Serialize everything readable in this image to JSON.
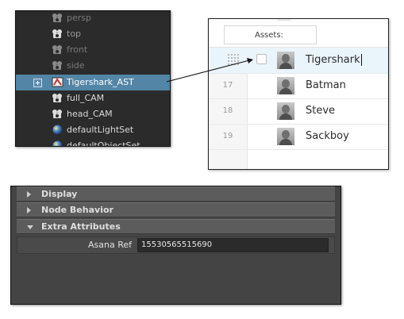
{
  "outliner": {
    "items": [
      {
        "label": "persp",
        "icon": "camera-icon",
        "state": "dim"
      },
      {
        "label": "top",
        "icon": "camera-icon",
        "state": "normal"
      },
      {
        "label": "front",
        "icon": "camera-icon",
        "state": "dim"
      },
      {
        "label": "side",
        "icon": "camera-icon",
        "state": "dim"
      },
      {
        "label": "Tigershark_AST",
        "icon": "asset-node-icon",
        "state": "selected"
      },
      {
        "label": "full_CAM",
        "icon": "camera-icon",
        "state": "normal"
      },
      {
        "label": "head_CAM",
        "icon": "camera-icon",
        "state": "normal"
      },
      {
        "label": "defaultLightSet",
        "icon": "sphere-icon",
        "state": "normal"
      },
      {
        "label": "defaultObjectSet",
        "icon": "sphere-icon",
        "state": "normal"
      }
    ]
  },
  "asana": {
    "section_header": "Assets:",
    "tasks": [
      {
        "number": "",
        "name": "Tigershark",
        "highlighted": true
      },
      {
        "number": "17",
        "name": "Batman",
        "highlighted": false
      },
      {
        "number": "18",
        "name": "Steve",
        "highlighted": false
      },
      {
        "number": "19",
        "name": "Sackboy",
        "highlighted": false
      }
    ]
  },
  "attribute_editor": {
    "sections": [
      {
        "title": "Display",
        "expanded": false
      },
      {
        "title": "Node Behavior",
        "expanded": false
      },
      {
        "title": "Extra Attributes",
        "expanded": true
      }
    ],
    "attribute": {
      "label": "Asana Ref",
      "value": "15530565515690"
    }
  },
  "colors": {
    "selection": "#5285a6",
    "outliner_bg": "#2b2b2b",
    "attr_panel_bg": "#444444",
    "asana_highlight": "#eaf4fb"
  }
}
